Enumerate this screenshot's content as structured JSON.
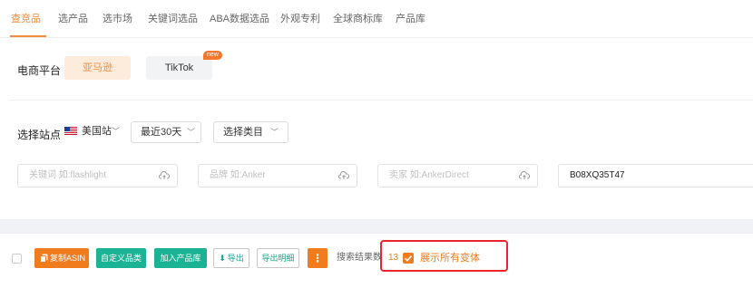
{
  "tabs": [
    {
      "label": "查竞品",
      "active": true
    },
    {
      "label": "选产品"
    },
    {
      "label": "选市场"
    },
    {
      "label": "关键词选品"
    },
    {
      "label": "ABA数据选品"
    },
    {
      "label": "外观专利"
    },
    {
      "label": "全球商标库"
    },
    {
      "label": "产品库"
    }
  ],
  "platform": {
    "label": "电商平台",
    "options": [
      "亚马逊",
      "TikTok"
    ],
    "selected": "亚马逊",
    "new_badge": "new"
  },
  "site": {
    "label": "选择站点",
    "selected": "美国站",
    "time_range": "最近30天",
    "category": "选择类目",
    "icon": "us-flag-icon"
  },
  "filters": {
    "keyword_placeholder": "关键词 如:flashlight",
    "brand_placeholder": "品牌 如:Anker",
    "seller_placeholder": "卖家 如:AnkerDirect",
    "asin_value": "B08XQ35T47"
  },
  "toolbar": {
    "copy_asin": "复制ASIN",
    "custom_category": "自定义品类",
    "add_to_library": "加入产品库",
    "export": "导出",
    "export_detail": "导出明细",
    "more": "⋮",
    "result_label": "搜索结果数",
    "result_count": "13",
    "show_variants": "展示所有变体",
    "show_variants_checked": true
  },
  "colors": {
    "accent": "#f07c1e",
    "green": "#1ab394",
    "highlight": "#e8262b"
  }
}
